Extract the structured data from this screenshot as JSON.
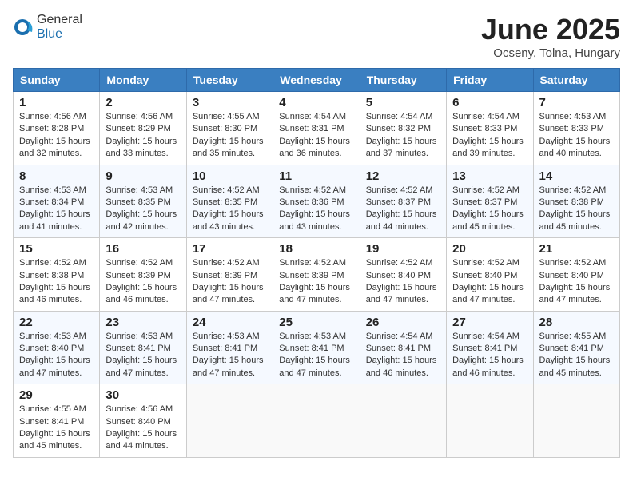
{
  "header": {
    "logo_general": "General",
    "logo_blue": "Blue",
    "month_title": "June 2025",
    "location": "Ocseny, Tolna, Hungary"
  },
  "days_of_week": [
    "Sunday",
    "Monday",
    "Tuesday",
    "Wednesday",
    "Thursday",
    "Friday",
    "Saturday"
  ],
  "weeks": [
    [
      {
        "day": "1",
        "sunrise": "Sunrise: 4:56 AM",
        "sunset": "Sunset: 8:28 PM",
        "daylight": "Daylight: 15 hours and 32 minutes."
      },
      {
        "day": "2",
        "sunrise": "Sunrise: 4:56 AM",
        "sunset": "Sunset: 8:29 PM",
        "daylight": "Daylight: 15 hours and 33 minutes."
      },
      {
        "day": "3",
        "sunrise": "Sunrise: 4:55 AM",
        "sunset": "Sunset: 8:30 PM",
        "daylight": "Daylight: 15 hours and 35 minutes."
      },
      {
        "day": "4",
        "sunrise": "Sunrise: 4:54 AM",
        "sunset": "Sunset: 8:31 PM",
        "daylight": "Daylight: 15 hours and 36 minutes."
      },
      {
        "day": "5",
        "sunrise": "Sunrise: 4:54 AM",
        "sunset": "Sunset: 8:32 PM",
        "daylight": "Daylight: 15 hours and 37 minutes."
      },
      {
        "day": "6",
        "sunrise": "Sunrise: 4:54 AM",
        "sunset": "Sunset: 8:33 PM",
        "daylight": "Daylight: 15 hours and 39 minutes."
      },
      {
        "day": "7",
        "sunrise": "Sunrise: 4:53 AM",
        "sunset": "Sunset: 8:33 PM",
        "daylight": "Daylight: 15 hours and 40 minutes."
      }
    ],
    [
      {
        "day": "8",
        "sunrise": "Sunrise: 4:53 AM",
        "sunset": "Sunset: 8:34 PM",
        "daylight": "Daylight: 15 hours and 41 minutes."
      },
      {
        "day": "9",
        "sunrise": "Sunrise: 4:53 AM",
        "sunset": "Sunset: 8:35 PM",
        "daylight": "Daylight: 15 hours and 42 minutes."
      },
      {
        "day": "10",
        "sunrise": "Sunrise: 4:52 AM",
        "sunset": "Sunset: 8:35 PM",
        "daylight": "Daylight: 15 hours and 43 minutes."
      },
      {
        "day": "11",
        "sunrise": "Sunrise: 4:52 AM",
        "sunset": "Sunset: 8:36 PM",
        "daylight": "Daylight: 15 hours and 43 minutes."
      },
      {
        "day": "12",
        "sunrise": "Sunrise: 4:52 AM",
        "sunset": "Sunset: 8:37 PM",
        "daylight": "Daylight: 15 hours and 44 minutes."
      },
      {
        "day": "13",
        "sunrise": "Sunrise: 4:52 AM",
        "sunset": "Sunset: 8:37 PM",
        "daylight": "Daylight: 15 hours and 45 minutes."
      },
      {
        "day": "14",
        "sunrise": "Sunrise: 4:52 AM",
        "sunset": "Sunset: 8:38 PM",
        "daylight": "Daylight: 15 hours and 45 minutes."
      }
    ],
    [
      {
        "day": "15",
        "sunrise": "Sunrise: 4:52 AM",
        "sunset": "Sunset: 8:38 PM",
        "daylight": "Daylight: 15 hours and 46 minutes."
      },
      {
        "day": "16",
        "sunrise": "Sunrise: 4:52 AM",
        "sunset": "Sunset: 8:39 PM",
        "daylight": "Daylight: 15 hours and 46 minutes."
      },
      {
        "day": "17",
        "sunrise": "Sunrise: 4:52 AM",
        "sunset": "Sunset: 8:39 PM",
        "daylight": "Daylight: 15 hours and 47 minutes."
      },
      {
        "day": "18",
        "sunrise": "Sunrise: 4:52 AM",
        "sunset": "Sunset: 8:39 PM",
        "daylight": "Daylight: 15 hours and 47 minutes."
      },
      {
        "day": "19",
        "sunrise": "Sunrise: 4:52 AM",
        "sunset": "Sunset: 8:40 PM",
        "daylight": "Daylight: 15 hours and 47 minutes."
      },
      {
        "day": "20",
        "sunrise": "Sunrise: 4:52 AM",
        "sunset": "Sunset: 8:40 PM",
        "daylight": "Daylight: 15 hours and 47 minutes."
      },
      {
        "day": "21",
        "sunrise": "Sunrise: 4:52 AM",
        "sunset": "Sunset: 8:40 PM",
        "daylight": "Daylight: 15 hours and 47 minutes."
      }
    ],
    [
      {
        "day": "22",
        "sunrise": "Sunrise: 4:53 AM",
        "sunset": "Sunset: 8:40 PM",
        "daylight": "Daylight: 15 hours and 47 minutes."
      },
      {
        "day": "23",
        "sunrise": "Sunrise: 4:53 AM",
        "sunset": "Sunset: 8:41 PM",
        "daylight": "Daylight: 15 hours and 47 minutes."
      },
      {
        "day": "24",
        "sunrise": "Sunrise: 4:53 AM",
        "sunset": "Sunset: 8:41 PM",
        "daylight": "Daylight: 15 hours and 47 minutes."
      },
      {
        "day": "25",
        "sunrise": "Sunrise: 4:53 AM",
        "sunset": "Sunset: 8:41 PM",
        "daylight": "Daylight: 15 hours and 47 minutes."
      },
      {
        "day": "26",
        "sunrise": "Sunrise: 4:54 AM",
        "sunset": "Sunset: 8:41 PM",
        "daylight": "Daylight: 15 hours and 46 minutes."
      },
      {
        "day": "27",
        "sunrise": "Sunrise: 4:54 AM",
        "sunset": "Sunset: 8:41 PM",
        "daylight": "Daylight: 15 hours and 46 minutes."
      },
      {
        "day": "28",
        "sunrise": "Sunrise: 4:55 AM",
        "sunset": "Sunset: 8:41 PM",
        "daylight": "Daylight: 15 hours and 45 minutes."
      }
    ],
    [
      {
        "day": "29",
        "sunrise": "Sunrise: 4:55 AM",
        "sunset": "Sunset: 8:41 PM",
        "daylight": "Daylight: 15 hours and 45 minutes."
      },
      {
        "day": "30",
        "sunrise": "Sunrise: 4:56 AM",
        "sunset": "Sunset: 8:40 PM",
        "daylight": "Daylight: 15 hours and 44 minutes."
      },
      null,
      null,
      null,
      null,
      null
    ]
  ]
}
